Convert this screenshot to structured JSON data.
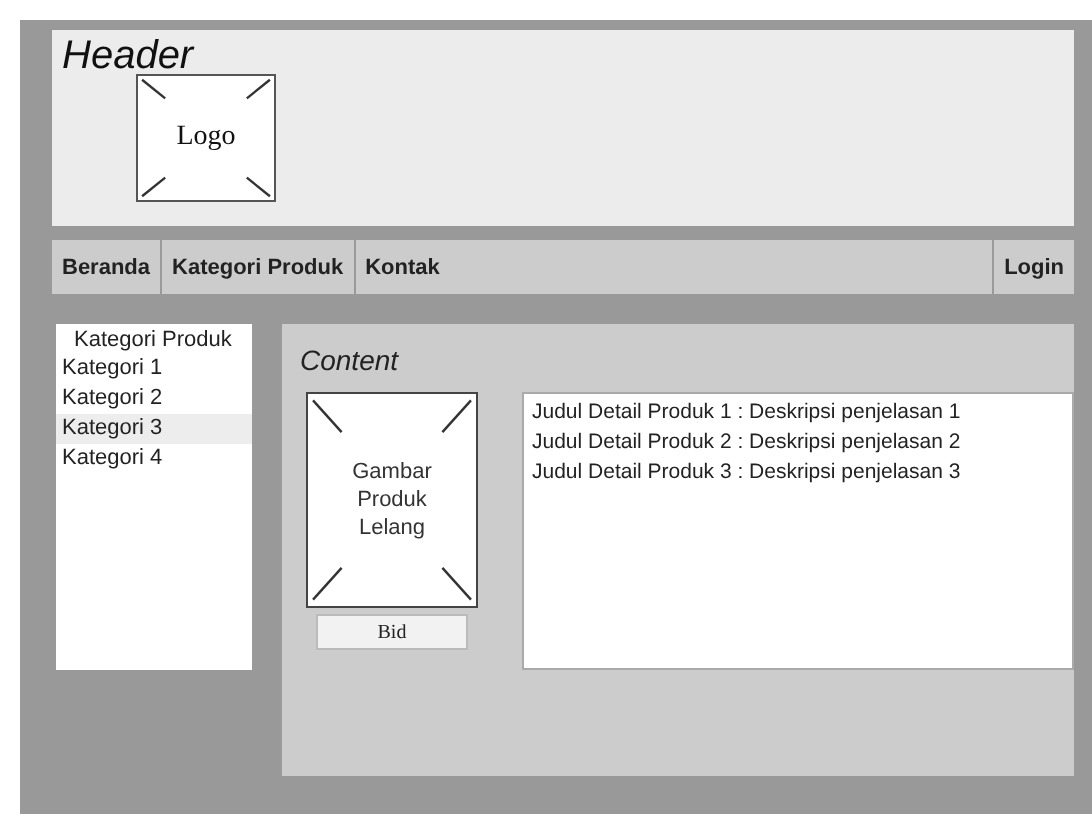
{
  "header": {
    "title": "Header",
    "logo": "Logo"
  },
  "nav": {
    "items": [
      {
        "label": "Beranda",
        "kind": "link"
      },
      {
        "label": "Kategori Produk",
        "kind": "link"
      },
      {
        "label": "Kontak",
        "kind": "wide"
      },
      {
        "label": "Login",
        "kind": "link"
      }
    ]
  },
  "sidebar": {
    "title": "Kategori Produk",
    "items": [
      {
        "label": "Kategori 1",
        "selected": false
      },
      {
        "label": "Kategori 2",
        "selected": false
      },
      {
        "label": "Kategori 3",
        "selected": true
      },
      {
        "label": "Kategori 4",
        "selected": false
      }
    ]
  },
  "content": {
    "title": "Content",
    "image": "Gambar Produk Lelang",
    "button": "Bid",
    "details": [
      "Judul Detail Produk 1 : Deskripsi penjelasan 1",
      "Judul Detail Produk 2 : Deskripsi penjelasan 2",
      "Judul Detail Produk 3 : Deskripsi penjelasan 3"
    ]
  }
}
